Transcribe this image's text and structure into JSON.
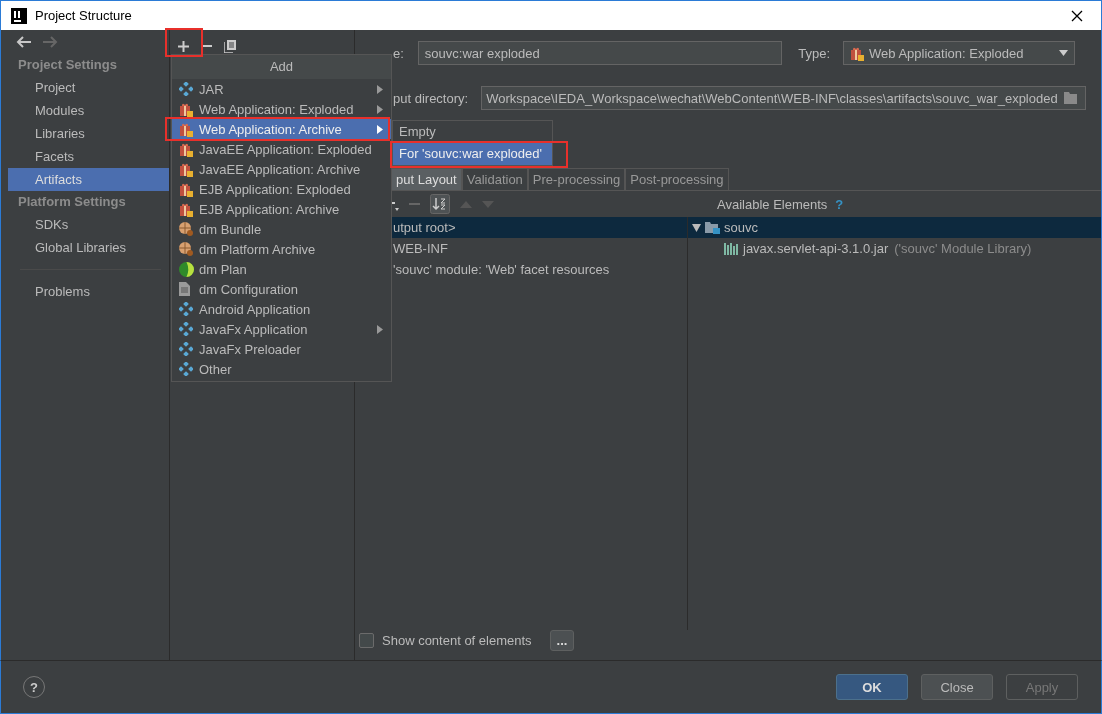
{
  "window": {
    "title": "Project Structure"
  },
  "sidebar": {
    "sections": [
      {
        "title": "Project Settings",
        "items": [
          {
            "label": "Project",
            "selected": false
          },
          {
            "label": "Modules",
            "selected": false
          },
          {
            "label": "Libraries",
            "selected": false
          },
          {
            "label": "Facets",
            "selected": false
          },
          {
            "label": "Artifacts",
            "selected": true
          }
        ]
      },
      {
        "title": "Platform Settings",
        "items": [
          {
            "label": "SDKs",
            "selected": false
          },
          {
            "label": "Global Libraries",
            "selected": false
          }
        ]
      }
    ],
    "extra_items": [
      {
        "label": "Problems",
        "selected": false
      }
    ]
  },
  "add_menu": {
    "title": "Add",
    "items": [
      {
        "label": "JAR",
        "kind": "diamond",
        "has_submenu": true,
        "selected": false
      },
      {
        "label": "Web Application: Exploded",
        "kind": "gift",
        "has_submenu": true,
        "selected": false
      },
      {
        "label": "Web Application: Archive",
        "kind": "gift",
        "has_submenu": true,
        "selected": true
      },
      {
        "label": "JavaEE Application: Exploded",
        "kind": "gift",
        "has_submenu": false,
        "selected": false
      },
      {
        "label": "JavaEE Application: Archive",
        "kind": "gift",
        "has_submenu": false,
        "selected": false
      },
      {
        "label": "EJB Application: Exploded",
        "kind": "gift",
        "has_submenu": false,
        "selected": false
      },
      {
        "label": "EJB Application: Archive",
        "kind": "gift",
        "has_submenu": false,
        "selected": false
      },
      {
        "label": "dm Bundle",
        "kind": "bundle",
        "has_submenu": false,
        "selected": false
      },
      {
        "label": "dm Platform Archive",
        "kind": "bundle",
        "has_submenu": false,
        "selected": false
      },
      {
        "label": "dm Plan",
        "kind": "plan",
        "has_submenu": false,
        "selected": false
      },
      {
        "label": "dm Configuration",
        "kind": "file",
        "has_submenu": false,
        "selected": false
      },
      {
        "label": "Android Application",
        "kind": "diamond",
        "has_submenu": false,
        "selected": false
      },
      {
        "label": "JavaFx Application",
        "kind": "diamond",
        "has_submenu": true,
        "selected": false
      },
      {
        "label": "JavaFx Preloader",
        "kind": "diamond",
        "has_submenu": false,
        "selected": false
      },
      {
        "label": "Other",
        "kind": "diamond",
        "has_submenu": false,
        "selected": false
      }
    ]
  },
  "submenu": {
    "items": [
      {
        "label": "Empty",
        "selected": false
      },
      {
        "label": "For 'souvc:war exploded'",
        "selected": true
      }
    ]
  },
  "editor": {
    "name_label": "e:",
    "name_value": "souvc:war exploded",
    "type_label": "Type:",
    "type_value": "Web Application: Exploded",
    "output_label": "put directory:",
    "output_value": "Workspace\\IEDA_Workspace\\wechat\\WebContent\\WEB-INF\\classes\\artifacts\\souvc_war_exploded",
    "tabs": [
      {
        "label": "put Layout",
        "selected": true
      },
      {
        "label": "Validation",
        "selected": false
      },
      {
        "label": "Pre-processing",
        "selected": false
      },
      {
        "label": "Post-processing",
        "selected": false
      }
    ],
    "available_label": "Available Elements",
    "available_help": "?",
    "layout_items": [
      {
        "label": "utput root>",
        "selected": true
      },
      {
        "label": "WEB-INF",
        "selected": false
      },
      {
        "label": "'souvc' module: 'Web' facet resources",
        "selected": false
      }
    ],
    "available_tree": [
      {
        "label": "souvc",
        "expanded": true,
        "selected": true,
        "children": [
          {
            "label": "javax.servlet-api-3.1.0.jar",
            "note": "('souvc' Module Library)"
          }
        ]
      }
    ],
    "show_content": {
      "label": "Show content of elements",
      "checked": false
    },
    "more_button": "..."
  },
  "footer": {
    "help": "?",
    "buttons": [
      {
        "label": "OK",
        "kind": "primary"
      },
      {
        "label": "Close",
        "kind": "normal"
      },
      {
        "label": "Apply",
        "kind": "disabled"
      }
    ]
  }
}
